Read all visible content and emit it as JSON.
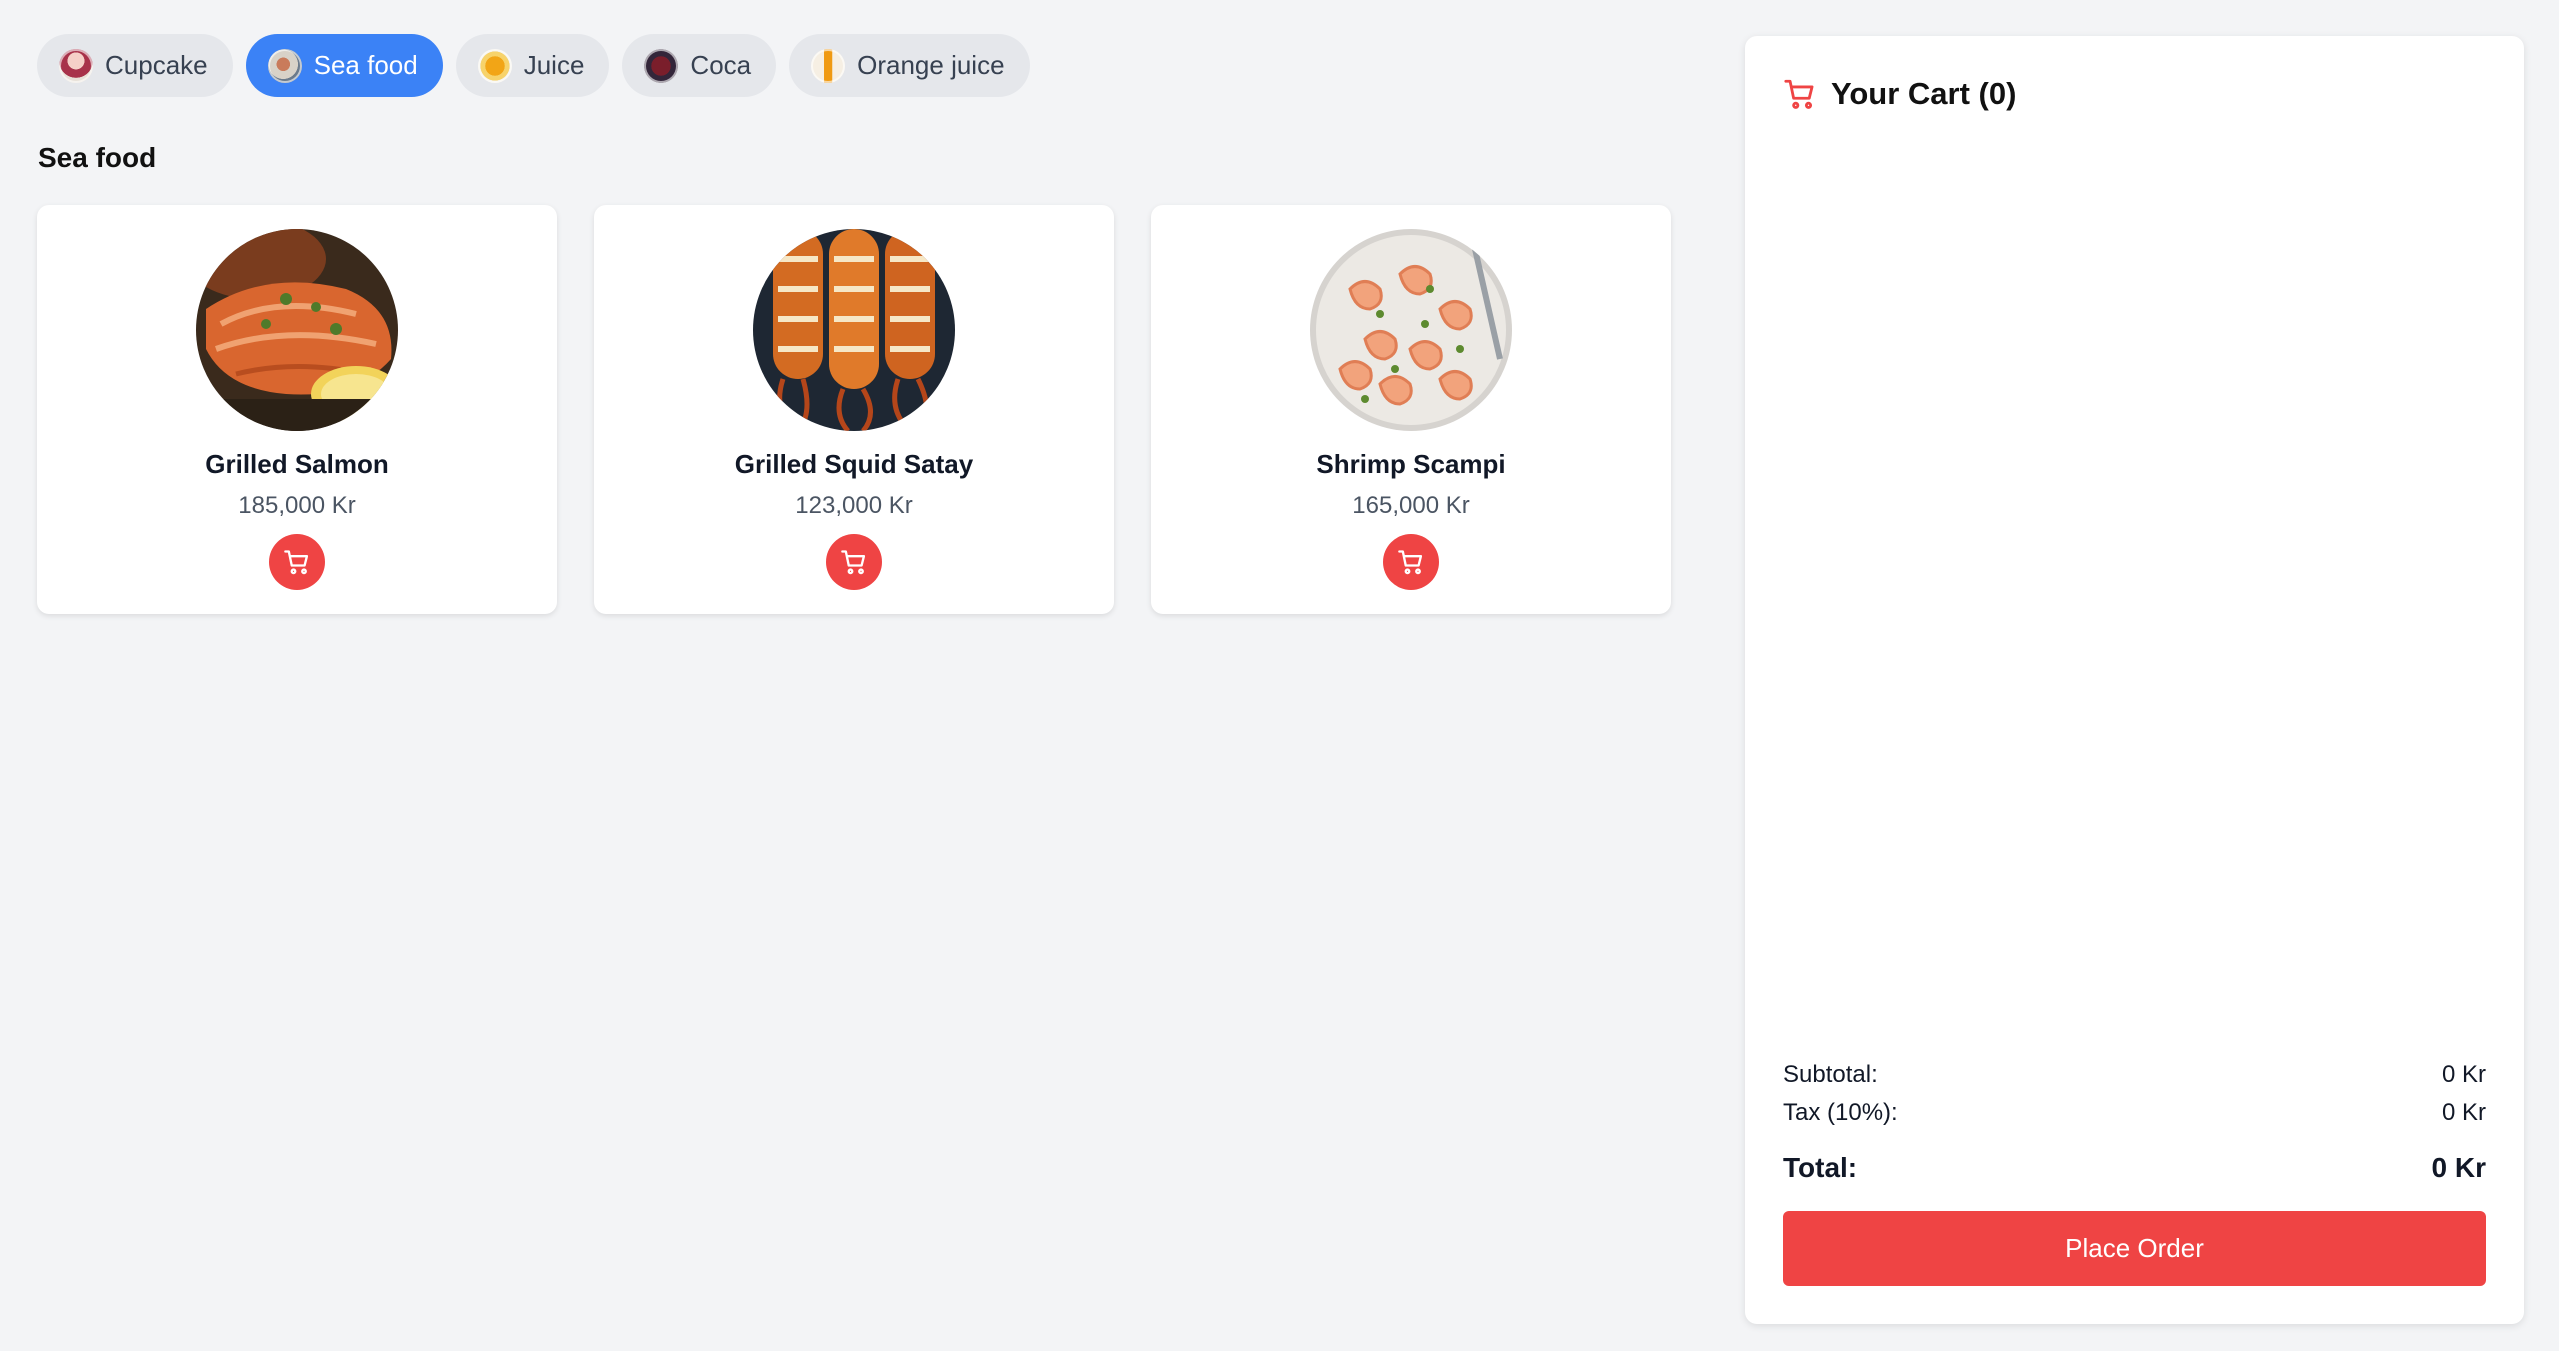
{
  "categories": [
    {
      "label": "Cupcake",
      "icon": "cupcake-thumbnail",
      "active": false
    },
    {
      "label": "Sea food",
      "icon": "seafood-thumbnail",
      "active": true
    },
    {
      "label": "Juice",
      "icon": "juice-thumbnail",
      "active": false
    },
    {
      "label": "Coca",
      "icon": "coca-thumbnail",
      "active": false
    },
    {
      "label": "Orange juice",
      "icon": "orange-juice-thumbnail",
      "active": false
    }
  ],
  "section": {
    "title": "Sea food"
  },
  "products": [
    {
      "name": "Grilled Salmon",
      "price": "185,000 Kr",
      "image": "grilled-salmon-photo"
    },
    {
      "name": "Grilled Squid Satay",
      "price": "123,000 Kr",
      "image": "grilled-squid-photo"
    },
    {
      "name": "Shrimp Scampi",
      "price": "165,000 Kr",
      "image": "shrimp-scampi-photo"
    }
  ],
  "cart": {
    "title": "Your Cart (0)",
    "subtotal_label": "Subtotal:",
    "subtotal_value": "0 Kr",
    "tax_label": "Tax (10%):",
    "tax_value": "0 Kr",
    "total_label": "Total:",
    "total_value": "0 Kr",
    "place_order_label": "Place Order"
  },
  "colors": {
    "accent_blue": "#3b82f6",
    "accent_red": "#ef4444",
    "background": "#f3f4f6"
  }
}
